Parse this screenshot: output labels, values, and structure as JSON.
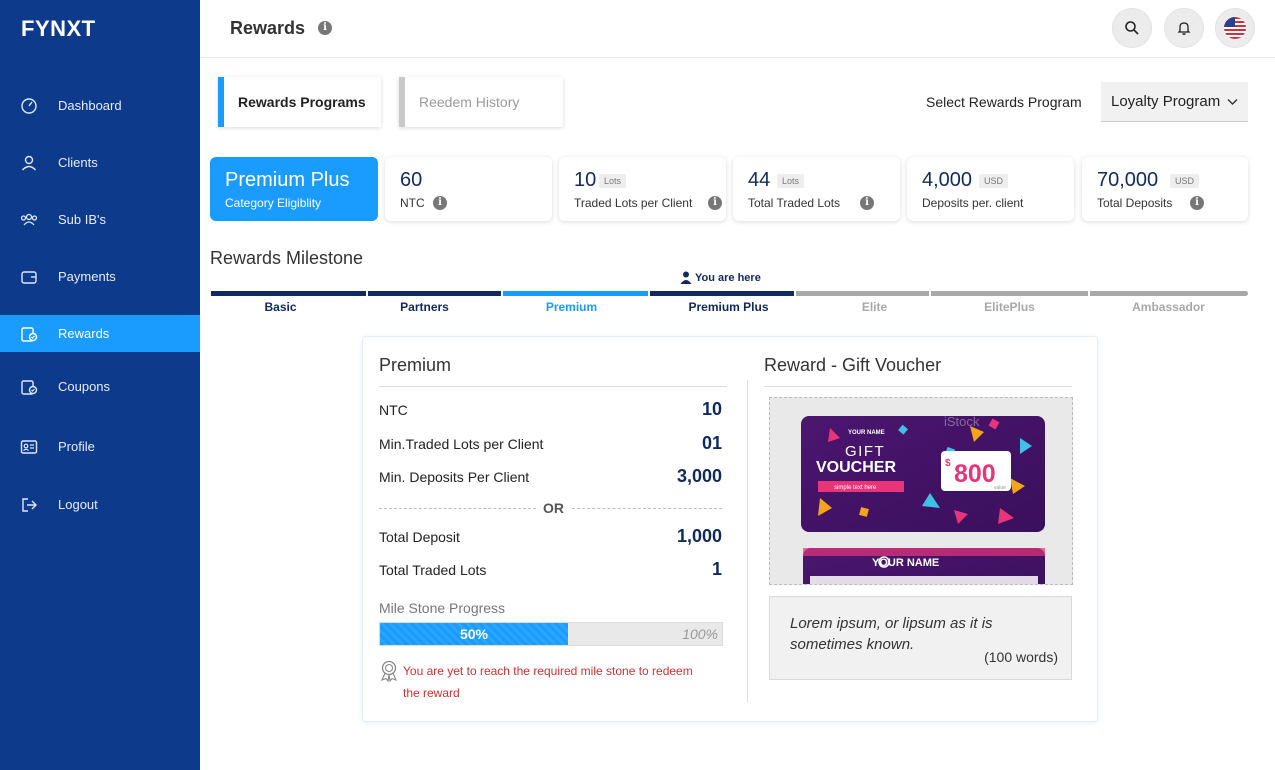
{
  "app": {
    "logo": "FYNXT"
  },
  "sidebar": {
    "items": [
      {
        "label": "Dashboard",
        "icon": "dashboard-icon"
      },
      {
        "label": "Clients",
        "icon": "user-icon"
      },
      {
        "label": "Sub IB's",
        "icon": "users-group-icon"
      },
      {
        "label": "Payments",
        "icon": "wallet-icon"
      },
      {
        "label": "Rewards",
        "icon": "rewards-icon",
        "active": true
      },
      {
        "label": "Coupons",
        "icon": "coupon-icon"
      },
      {
        "label": "Profile",
        "icon": "profile-card-icon"
      },
      {
        "label": "Logout",
        "icon": "logout-icon"
      }
    ]
  },
  "header": {
    "title": "Rewards",
    "info_icon": "i"
  },
  "tabs": [
    {
      "label": "Rewards Programs",
      "active": true
    },
    {
      "label": "Reedem History",
      "active": false
    }
  ],
  "program_select": {
    "label": "Select Rewards Program",
    "value": "Loyalty Program"
  },
  "stats": {
    "category": {
      "value": "Premium Plus",
      "label": "Category Eligiblity"
    },
    "items": [
      {
        "value": "60",
        "unit": "",
        "label": "NTC"
      },
      {
        "value": "10",
        "unit": "Lots",
        "label": "Traded Lots per Client"
      },
      {
        "value": "44",
        "unit": "Lots",
        "label": "Total Traded Lots"
      },
      {
        "value": "4,000",
        "unit": "USD",
        "label": "Deposits per. client"
      },
      {
        "value": "70,000",
        "unit": "USD",
        "label": "Total Deposits"
      }
    ]
  },
  "milestone": {
    "title": "Rewards Milestone",
    "you_are_here": "You are here",
    "stages": [
      {
        "label": "Basic",
        "state": "completed"
      },
      {
        "label": "Partners",
        "state": "completed"
      },
      {
        "label": "Premium",
        "state": "selected"
      },
      {
        "label": "Premium Plus",
        "state": "current"
      },
      {
        "label": "Elite",
        "state": "locked"
      },
      {
        "label": "ElitePlus",
        "state": "locked"
      },
      {
        "label": "Ambassador",
        "state": "locked"
      }
    ]
  },
  "detail": {
    "title": "Premium",
    "rows_top": [
      {
        "label": "NTC",
        "value": "10"
      },
      {
        "label": "Min.Traded Lots per Client",
        "value": "01"
      },
      {
        "label": "Min. Deposits Per Client",
        "value": "3,000"
      }
    ],
    "or_text": "OR",
    "rows_bottom": [
      {
        "label": "Total Deposit",
        "value": "1,000"
      },
      {
        "label": "Total Traded Lots",
        "value": "1"
      }
    ],
    "progress": {
      "label": "Mile Stone Progress",
      "percent": 50,
      "value_text": "50%",
      "max_text": "100%"
    },
    "warning": "You are yet to reach the required mile stone to redeem the reward"
  },
  "reward": {
    "title": "Reward - Gift Voucher",
    "voucher": {
      "brand_small": "YOUR NAME",
      "line1": "GIFT",
      "line2": "VOUCHER",
      "tagline": "simple text here",
      "currency": "$",
      "amount": "800",
      "amount_sub": "value",
      "brand_bottom": "YOUR NAME",
      "watermark": "iStock"
    },
    "description": "Lorem ipsum, or lipsum as it is sometimes known.",
    "words": "(100 words)"
  },
  "colors": {
    "sidebar": "#0e3a8c",
    "accent": "#1a9cff",
    "navy": "#0e2a5e",
    "locked": "#a8a8a8",
    "warning": "#d32f2f"
  }
}
